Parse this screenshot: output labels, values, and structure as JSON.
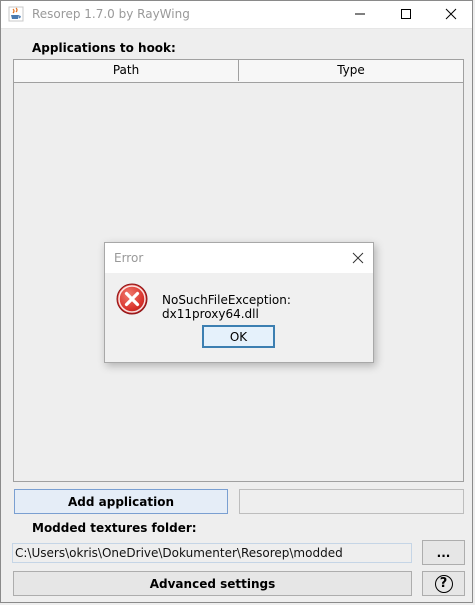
{
  "window": {
    "title": "Resorep 1.7.0 by RayWing",
    "icon": "java-cup-icon"
  },
  "applications": {
    "label": "Applications to hook:",
    "columns": [
      "Path",
      "Type"
    ],
    "rows": []
  },
  "actions": {
    "add_application": "Add application"
  },
  "textures": {
    "label": "Modded textures folder:",
    "path": "C:\\Users\\okris\\OneDrive\\Dokumenter\\Resorep\\modded",
    "browse": "..."
  },
  "footer": {
    "advanced": "Advanced settings",
    "help": "?"
  },
  "dialog": {
    "title": "Error",
    "message": "NoSuchFileException: dx11proxy64.dll",
    "ok": "OK",
    "icon": "error-icon"
  },
  "colors": {
    "error_red": "#d9322b",
    "focus_blue": "#3c7fb1"
  }
}
